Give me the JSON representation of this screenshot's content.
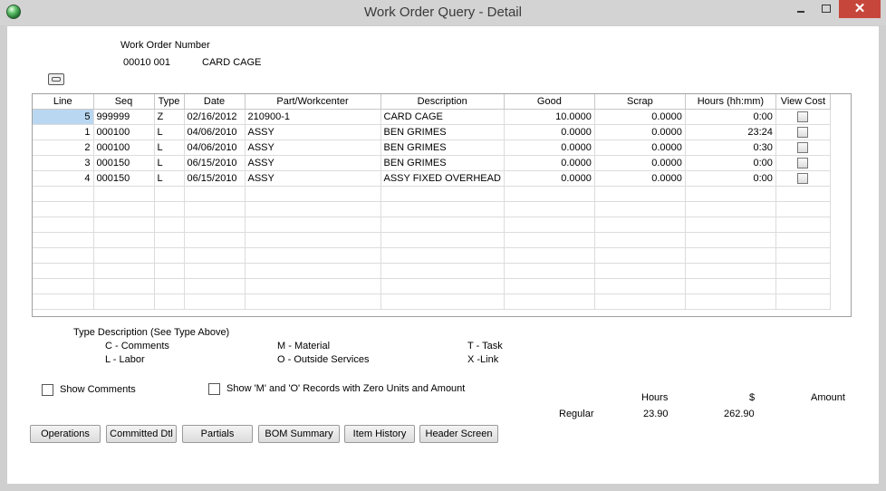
{
  "window": {
    "title": "Work Order Query - Detail",
    "close_glyph": "✕"
  },
  "work_order": {
    "label": "Work Order Number",
    "number": "00010 001",
    "description": "CARD CAGE"
  },
  "grid": {
    "columns": [
      "Line",
      "Seq",
      "Type",
      "Date",
      "Part/Workcenter",
      "Description",
      "Good",
      "Scrap",
      "Hours (hh:mm)",
      "View Cost"
    ],
    "rows": [
      {
        "line": "5",
        "seq": "999999",
        "type": "Z",
        "date": "02/16/2012",
        "part": "210900-1",
        "description": "CARD CAGE",
        "good": "10.0000",
        "scrap": "0.0000",
        "hours": "0:00"
      },
      {
        "line": "1",
        "seq": "000100",
        "type": "L",
        "date": "04/06/2010",
        "part": "ASSY",
        "description": "BEN GRIMES",
        "good": "0.0000",
        "scrap": "0.0000",
        "hours": "23:24"
      },
      {
        "line": "2",
        "seq": "000100",
        "type": "L",
        "date": "04/06/2010",
        "part": "ASSY",
        "description": "BEN GRIMES",
        "good": "0.0000",
        "scrap": "0.0000",
        "hours": "0:30"
      },
      {
        "line": "3",
        "seq": "000150",
        "type": "L",
        "date": "06/15/2010",
        "part": "ASSY",
        "description": "BEN GRIMES",
        "good": "0.0000",
        "scrap": "0.0000",
        "hours": "0:00"
      },
      {
        "line": "4",
        "seq": "000150",
        "type": "L",
        "date": "06/15/2010",
        "part": "ASSY",
        "description": "ASSY FIXED OVERHEAD",
        "good": "0.0000",
        "scrap": "0.0000",
        "hours": "0:00"
      }
    ]
  },
  "type_legend": {
    "title": "Type Description (See Type Above)",
    "items": [
      "C - Comments",
      "L - Labor",
      "M - Material",
      "O - Outside Services",
      "T - Task",
      "X -Link"
    ]
  },
  "options": {
    "show_comments": "Show Comments",
    "show_zero": "Show 'M' and 'O' Records with Zero Units and Amount"
  },
  "totals": {
    "hours_header": "Hours",
    "dollar_header": "$",
    "amount_header": "Amount",
    "row_label": "Regular",
    "hours": "23.90",
    "dollars": "262.90"
  },
  "buttons": {
    "operations": "Operations",
    "committed": "Committed Dtl",
    "partials": "Partials",
    "bom": "BOM Summary",
    "item_history": "Item History",
    "header_screen": "Header Screen"
  }
}
